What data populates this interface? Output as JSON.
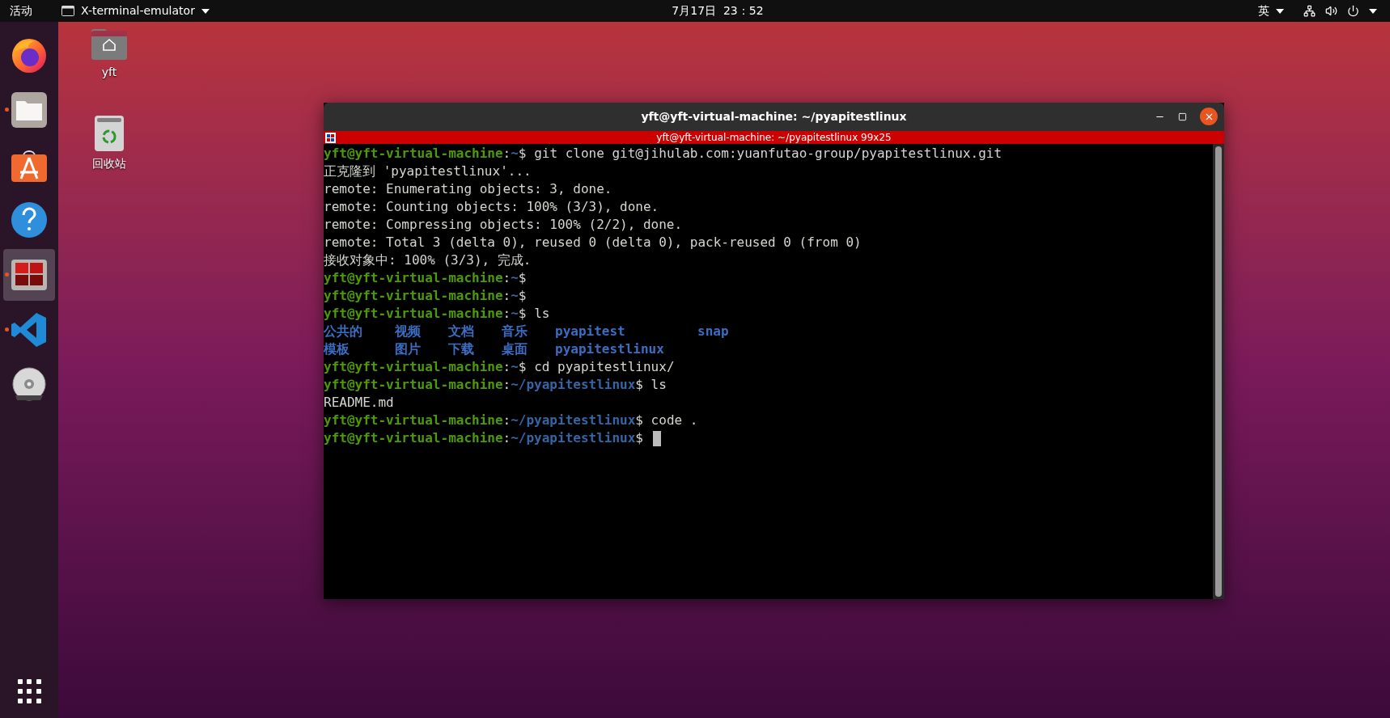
{
  "top_bar": {
    "activities": "活动",
    "app_menu": "X-terminal-emulator",
    "clock": "7月17日  23：52",
    "input_method": "英"
  },
  "dock": [
    {
      "kind": "browser",
      "running": false,
      "selected": false
    },
    {
      "kind": "files",
      "running": true,
      "selected": false
    },
    {
      "kind": "store",
      "running": false,
      "selected": false
    },
    {
      "kind": "help",
      "running": false,
      "selected": false
    },
    {
      "kind": "terminal",
      "running": true,
      "selected": true
    },
    {
      "kind": "editor",
      "running": true,
      "selected": false
    },
    {
      "kind": "disc",
      "running": false,
      "selected": false
    }
  ],
  "desktop_icons": [
    {
      "kind": "home",
      "label": "yft"
    },
    {
      "kind": "trash",
      "label": "回收站"
    }
  ],
  "window": {
    "title": "yft@yft-virtual-machine: ~/pyapitestlinux",
    "tab_title": "yft@yft-virtual-machine: ~/pyapitestlinux 99x25",
    "lines": [
      {
        "kind": "prompt",
        "user": "yft@yft-virtual-machine",
        "separator": ":",
        "path": "~",
        "symbol": "$",
        "command": "git clone git@jihulab.com:yuanfutao-group/pyapitestlinux.git"
      },
      {
        "kind": "output",
        "text": "正克隆到 'pyapitestlinux'..."
      },
      {
        "kind": "output",
        "text": "remote: Enumerating objects: 3, done."
      },
      {
        "kind": "output",
        "text": "remote: Counting objects: 100% (3/3), done."
      },
      {
        "kind": "output",
        "text": "remote: Compressing objects: 100% (2/2), done."
      },
      {
        "kind": "output",
        "text": "remote: Total 3 (delta 0), reused 0 (delta 0), pack-reused 0 (from 0)"
      },
      {
        "kind": "output",
        "text": "接收对象中: 100% (3/3), 完成."
      },
      {
        "kind": "prompt",
        "user": "yft@yft-virtual-machine",
        "separator": ":",
        "path": "~",
        "symbol": "$"
      },
      {
        "kind": "prompt",
        "user": "yft@yft-virtual-machine",
        "separator": ":",
        "path": "~",
        "symbol": "$"
      },
      {
        "kind": "prompt",
        "user": "yft@yft-virtual-machine",
        "separator": ":",
        "path": "~",
        "symbol": "$",
        "command": "ls"
      },
      {
        "kind": "listing",
        "items": [
          "公共的",
          "视频",
          "文档",
          "音乐",
          "pyapitest",
          "snap"
        ]
      },
      {
        "kind": "listing",
        "items": [
          "模板",
          "图片",
          "下载",
          "桌面",
          "pyapitestlinux"
        ]
      },
      {
        "kind": "prompt",
        "user": "yft@yft-virtual-machine",
        "separator": ":",
        "path": "~",
        "symbol": "$",
        "command": "cd pyapitestlinux/"
      },
      {
        "kind": "prompt",
        "user": "yft@yft-virtual-machine",
        "separator": ":",
        "path": "~/pyapitestlinux",
        "symbol": "$",
        "command": "ls"
      },
      {
        "kind": "output",
        "text": "README.md"
      },
      {
        "kind": "prompt",
        "user": "yft@yft-virtual-machine",
        "separator": ":",
        "path": "~/pyapitestlinux",
        "symbol": "$",
        "command": "code ."
      },
      {
        "kind": "prompt",
        "user": "yft@yft-virtual-machine",
        "separator": ":",
        "path": "~/pyapitestlinux",
        "symbol": "$",
        "cursor": true
      }
    ]
  }
}
